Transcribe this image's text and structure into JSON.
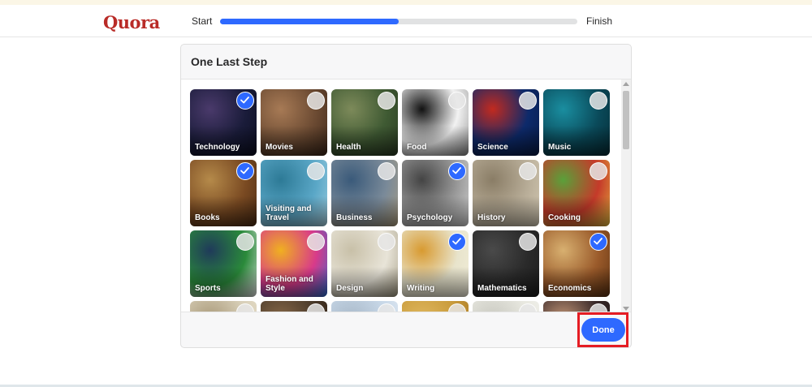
{
  "header": {
    "logo": "Quora",
    "progress_start": "Start",
    "progress_finish": "Finish",
    "progress_fraction": 0.5
  },
  "modal": {
    "title": "One Last Step",
    "done_label": "Done"
  },
  "topics": [
    {
      "label": "Technology",
      "selected": true,
      "colors": [
        "#1a1c3a",
        "#4a3a6b",
        "#0b0d20"
      ]
    },
    {
      "label": "Movies",
      "selected": false,
      "colors": [
        "#6b4a32",
        "#a77a55",
        "#3b2618"
      ]
    },
    {
      "label": "Health",
      "selected": false,
      "colors": [
        "#3f5a33",
        "#7d8a5a",
        "#2a3a22"
      ]
    },
    {
      "label": "Food",
      "selected": false,
      "colors": [
        "#f2f2f2",
        "#111111",
        "#888888"
      ]
    },
    {
      "label": "Science",
      "selected": false,
      "colors": [
        "#0d2a6b",
        "#c22a1f",
        "#071a44"
      ]
    },
    {
      "label": "Music",
      "selected": false,
      "colors": [
        "#0a4a5a",
        "#1a8ea0",
        "#052a33"
      ]
    },
    {
      "label": "Books",
      "selected": true,
      "colors": [
        "#7a4a22",
        "#b58a4a",
        "#4a2a12"
      ]
    },
    {
      "label": "Visiting and Travel",
      "selected": false,
      "colors": [
        "#5aa7c7",
        "#2d7a96",
        "#a9d3e3"
      ]
    },
    {
      "label": "Business",
      "selected": false,
      "colors": [
        "#7a8a99",
        "#3a5a7a",
        "#b0a080"
      ]
    },
    {
      "label": "Psychology",
      "selected": true,
      "colors": [
        "#9a9a9a",
        "#444444",
        "#d9d9d9"
      ]
    },
    {
      "label": "History",
      "selected": false,
      "colors": [
        "#b8ad98",
        "#8a7d66",
        "#d8ceb8"
      ]
    },
    {
      "label": "Cooking",
      "selected": false,
      "colors": [
        "#c53a2a",
        "#5aa03a",
        "#e8c040"
      ]
    },
    {
      "label": "Sports",
      "selected": false,
      "colors": [
        "#2a8a3a",
        "#1f3a5a",
        "#e8e8e8"
      ]
    },
    {
      "label": "Fashion and Style",
      "selected": false,
      "colors": [
        "#d83a8a",
        "#f0b020",
        "#2a6ad0"
      ]
    },
    {
      "label": "Design",
      "selected": false,
      "colors": [
        "#e8e4d8",
        "#c8c0a8",
        "#a09880"
      ]
    },
    {
      "label": "Writing",
      "selected": true,
      "colors": [
        "#e8e4cc",
        "#d89a30",
        "#f4f0dc"
      ]
    },
    {
      "label": "Mathematics",
      "selected": false,
      "colors": [
        "#2a2a2a",
        "#4a4a4a",
        "#1a1a1a"
      ]
    },
    {
      "label": "Economics",
      "selected": true,
      "colors": [
        "#9a5a2a",
        "#d8b070",
        "#5a3010"
      ]
    },
    {
      "label": "",
      "selected": false,
      "colors": [
        "#d8cfb8",
        "#a89878",
        "#e8e0cc"
      ]
    },
    {
      "label": "",
      "selected": false,
      "colors": [
        "#4a3a2a",
        "#8a6a4a",
        "#2a1a10"
      ]
    },
    {
      "label": "",
      "selected": false,
      "colors": [
        "#c8d8e8",
        "#a8b8c8",
        "#e8eef4"
      ]
    },
    {
      "label": "",
      "selected": false,
      "colors": [
        "#c89a3a",
        "#e0b860",
        "#a07020"
      ]
    },
    {
      "label": "",
      "selected": false,
      "colors": [
        "#e8e8e0",
        "#c8c8c0",
        "#f4f4f0"
      ]
    },
    {
      "label": "",
      "selected": false,
      "colors": [
        "#3a2a2a",
        "#c89a7a",
        "#1a1010"
      ]
    }
  ]
}
